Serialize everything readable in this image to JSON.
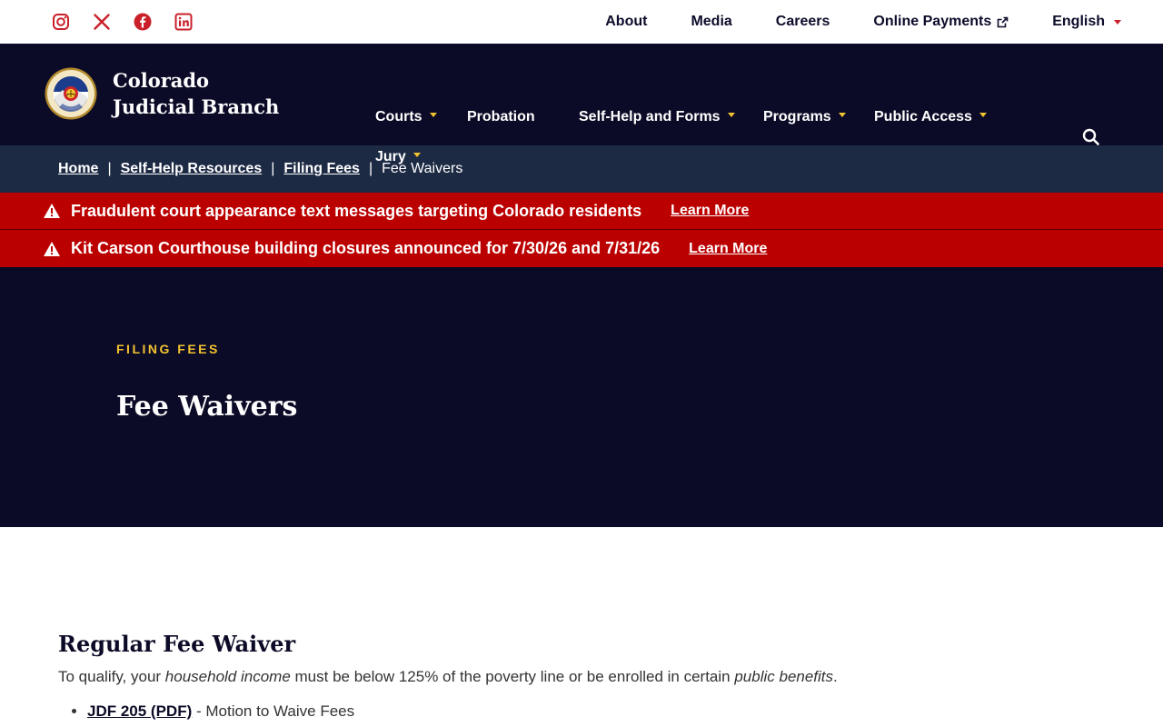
{
  "social": [
    {
      "name": "instagram-icon"
    },
    {
      "name": "x-icon"
    },
    {
      "name": "facebook-icon"
    },
    {
      "name": "linkedin-icon"
    }
  ],
  "utility": {
    "about": "About",
    "media": "Media",
    "careers": "Careers",
    "online_payments": "Online Payments",
    "language": "English"
  },
  "brand": {
    "name": "Colorado Judicial Branch"
  },
  "nav": {
    "courts": "Courts",
    "probation": "Probation",
    "self_help": "Self-Help and Forms",
    "programs": "Programs",
    "public_access": "Public Access",
    "jury": "Jury"
  },
  "breadcrumb": {
    "home": "Home",
    "self_help_resources": "Self-Help Resources",
    "filing_fees": "Filing Fees",
    "current": "Fee Waivers",
    "separator": "|"
  },
  "alerts": [
    {
      "message": "Fraudulent court appearance text messages targeting Colorado residents",
      "link": "Learn More"
    },
    {
      "message": "Kit Carson Courthouse building closures announced for 7/30/26 and 7/31/26",
      "link": "Learn More"
    }
  ],
  "hero": {
    "eyebrow": "FILING FEES",
    "title": "Fee Waivers"
  },
  "content": {
    "heading": "Regular Fee Waiver",
    "intro_start": "To qualify, your ",
    "intro_em1": "household income",
    "intro_mid": " must be below 125% of the poverty line or be enrolled in certain ",
    "intro_em2": "public benefits",
    "intro_end": ".",
    "items": [
      {
        "link": "JDF 205 (PDF)",
        "text": " - Motion to Waive Fees"
      }
    ]
  },
  "colors": {
    "navy": "#0c0b27",
    "breadcrumb_bg": "#1d2a44",
    "alert_red": "#bb0000",
    "gold": "#f2c230",
    "social_red": "#c9202a"
  }
}
